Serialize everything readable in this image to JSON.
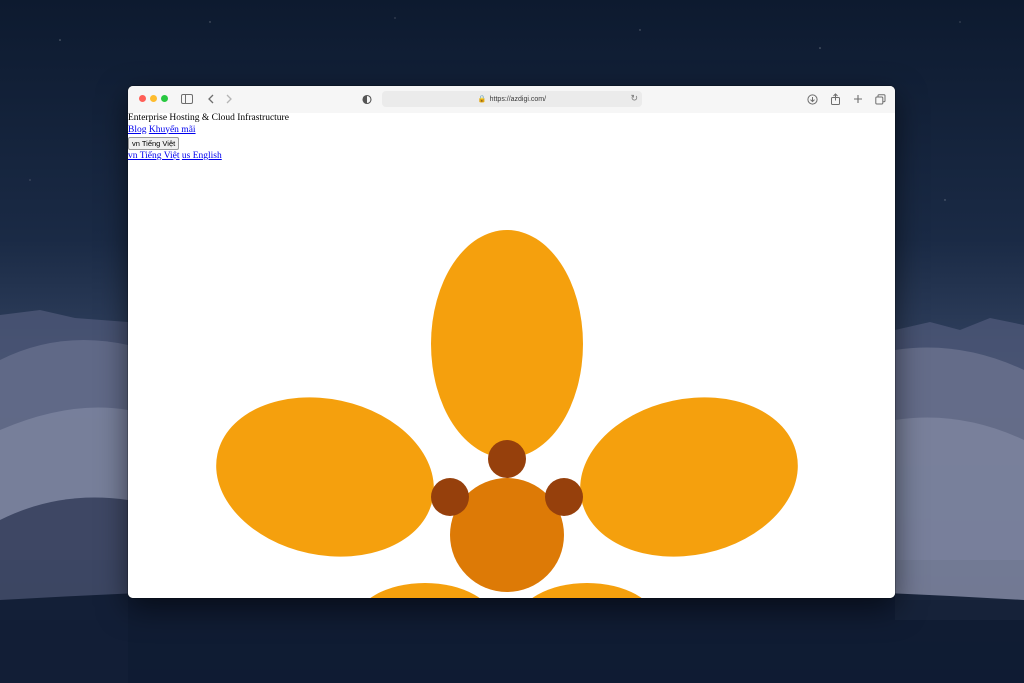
{
  "browser": {
    "url": "https://azdigi.com/",
    "icons": {
      "sidebar": "sidebar-icon",
      "back": "chevron-left-icon",
      "forward": "chevron-right-icon",
      "shield": "privacy-shield-icon",
      "lock": "lock-icon",
      "reload": "reload-icon",
      "download": "download-icon",
      "share": "share-icon",
      "new_tab": "plus-icon",
      "tabs": "tab-overview-icon"
    }
  },
  "page": {
    "tagline": "Enterprise Hosting & Cloud Infrastructure",
    "nav": {
      "blog": "Blog",
      "promo": "Khuyến mãi"
    },
    "language_button": "vn Tiếng Việt",
    "languages": [
      {
        "label": "vn Tiếng Việt"
      },
      {
        "label": "us English"
      }
    ]
  },
  "colors": {
    "petal": "#f5a00d",
    "center": "#dd7a06",
    "dots": "#96400c"
  }
}
